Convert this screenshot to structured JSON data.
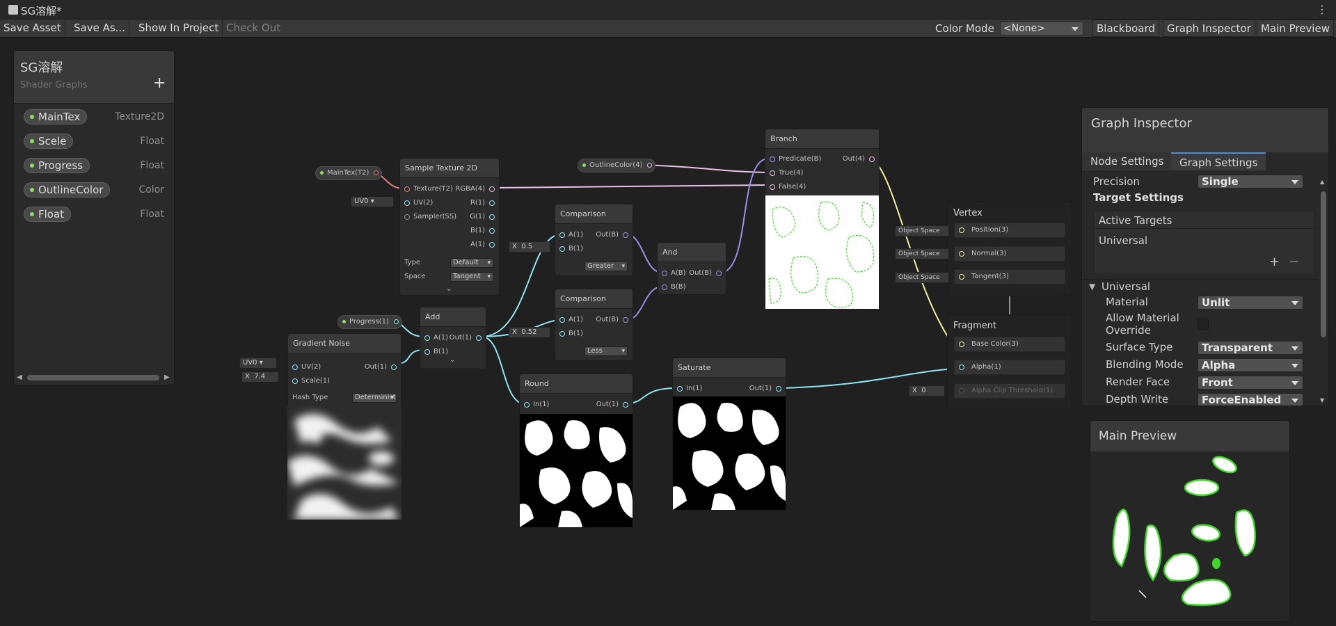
{
  "window": {
    "title": "SG溶解*"
  },
  "toolbar": {
    "save_asset": "Save Asset",
    "save_as": "Save As...",
    "show_in_project": "Show In Project",
    "check_out": "Check Out",
    "color_mode_label": "Color Mode",
    "color_mode_value": "<None>",
    "blackboard": "Blackboard",
    "graph_inspector": "Graph Inspector",
    "main_preview": "Main Preview"
  },
  "blackboard": {
    "title": "SG溶解",
    "subtitle": "Shader Graphs",
    "add": "+",
    "properties": [
      {
        "name": "MainTex",
        "type": "Texture2D"
      },
      {
        "name": "Scele",
        "type": "Float"
      },
      {
        "name": "Progress",
        "type": "Float"
      },
      {
        "name": "OutlineColor",
        "type": "Color"
      },
      {
        "name": "Float",
        "type": "Float"
      }
    ]
  },
  "graph": {
    "maintex_pill": "MainTex(T2)",
    "outline_pill": "OutlineColor(4)",
    "progress_pill": "Progress(1)",
    "sample_texture": {
      "title": "Sample Texture 2D",
      "in_texture": "Texture(T2)",
      "in_uv": "UV(2)",
      "in_sampler": "Sampler(SS)",
      "out_rgba": "RGBA(4)",
      "out_r": "R(1)",
      "out_g": "G(1)",
      "out_b": "B(1)",
      "out_a": "A(1)",
      "type_label": "Type",
      "type_value": "Default",
      "space_label": "Space",
      "space_value": "Tangent",
      "uv_field": "UV0"
    },
    "gradient_noise": {
      "title": "Gradient Noise",
      "in_uv": "UV(2)",
      "in_scale": "Scale(1)",
      "out": "Out(1)",
      "hash_label": "Hash Type",
      "hash_value": "Deterministi",
      "uv_field": "UV0",
      "x_label": "X",
      "x_value": "7.4"
    },
    "add": {
      "title": "Add",
      "in_a": "A(1)",
      "in_b": "B(1)",
      "out": "Out(1)"
    },
    "comparison1": {
      "title": "Comparison",
      "in_a": "A(1)",
      "in_b": "B(1)",
      "out": "Out(B)",
      "mode": "Greater",
      "x_label": "X",
      "x_value": "0.5"
    },
    "comparison2": {
      "title": "Comparison",
      "in_a": "A(1)",
      "in_b": "B(1)",
      "out": "Out(B)",
      "mode": "Less",
      "x_label": "X",
      "x_value": "0.52"
    },
    "and": {
      "title": "And",
      "in_a": "A(B)",
      "in_b": "B(B)",
      "out": "Out(B)"
    },
    "branch": {
      "title": "Branch",
      "in_pred": "Predicate(B)",
      "in_true": "True(4)",
      "in_false": "False(4)",
      "out": "Out(4)"
    },
    "round": {
      "title": "Round",
      "in": "In(1)",
      "out": "Out(1)"
    },
    "saturate": {
      "title": "Saturate",
      "in": "In(1)",
      "out": "Out(1)"
    },
    "vertex": {
      "title": "Vertex",
      "space": "Object Space",
      "position": "Position(3)",
      "normal": "Normal(3)",
      "tangent": "Tangent(3)"
    },
    "fragment": {
      "title": "Fragment",
      "base_color": "Base Color(3)",
      "alpha": "Alpha(1)",
      "alpha_clip": "Alpha Clip Threshold(1)",
      "x_label": "X",
      "x_value": "0"
    }
  },
  "inspector": {
    "title": "Graph Inspector",
    "tab_node": "Node Settings",
    "tab_graph": "Graph Settings",
    "precision_label": "Precision",
    "precision_value": "Single",
    "target_settings": "Target Settings",
    "active_targets": "Active Targets",
    "target_item": "Universal",
    "add": "+",
    "remove": "−",
    "section": "Universal",
    "material_label": "Material",
    "material_value": "Unlit",
    "allow_override_label": "Allow Material Override",
    "surface_label": "Surface Type",
    "surface_value": "Transparent",
    "blend_label": "Blending Mode",
    "blend_value": "Alpha",
    "render_face_label": "Render Face",
    "render_face_value": "Front",
    "depth_write_label": "Depth Write",
    "depth_write_value": "ForceEnabled"
  },
  "main_preview": {
    "title": "Main Preview"
  },
  "colors": {
    "background": "#202020",
    "texture_wire": "#e07a7a",
    "float_wire": "#8fe6f0",
    "bool_wire": "#9d8fe8",
    "vector4_wire": "#e8c3e8",
    "vector3_wire": "#f0f0a0",
    "outline_green": "#3dd825"
  }
}
